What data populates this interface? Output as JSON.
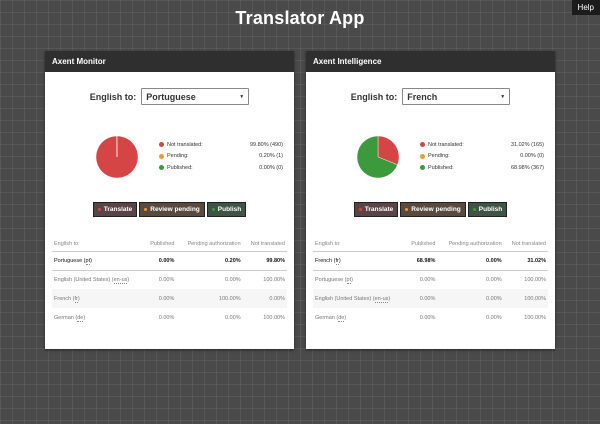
{
  "help_label": "Help",
  "app_title": "Translator App",
  "colors": {
    "not_translated": "#d64545",
    "pending": "#ee9a2b",
    "published": "#3c9a3c"
  },
  "legend_labels": {
    "not_translated": "Not translated:",
    "pending": "Pending:",
    "published": "Published:"
  },
  "buttons": {
    "translate": "Translate",
    "review": "Review pending",
    "publish": "Publish"
  },
  "table_headers": [
    "English to:",
    "Published",
    "Pending authorization",
    "Not translated"
  ],
  "panels": [
    {
      "title": "Axent Monitor",
      "source_label": "English to:",
      "selected_language": "Portuguese",
      "stats": {
        "not_translated": "99.80% (490)",
        "pending": "0.20% (1)",
        "published": "0.00% (0)"
      },
      "chart_data": {
        "type": "pie",
        "values": [
          99.8,
          0.2,
          0.0
        ]
      },
      "rows": [
        {
          "lang": "Portuguese",
          "code": "pt",
          "published": "0.00%",
          "pending": "0.20%",
          "not_translated": "99.80%"
        },
        {
          "lang": "English (United States)",
          "code": "en-us",
          "published": "0.00%",
          "pending": "0.00%",
          "not_translated": "100.00%"
        },
        {
          "lang": "French",
          "code": "fr",
          "published": "0.00%",
          "pending": "100.00%",
          "not_translated": "0.00%"
        },
        {
          "lang": "German",
          "code": "de",
          "published": "0.00%",
          "pending": "0.00%",
          "not_translated": "100.00%"
        }
      ]
    },
    {
      "title": "Axent Intelligence",
      "source_label": "English to:",
      "selected_language": "French",
      "stats": {
        "not_translated": "31.02% (165)",
        "pending": "0.00% (0)",
        "published": "68.98% (367)"
      },
      "chart_data": {
        "type": "pie",
        "values": [
          31.02,
          0.0,
          68.98
        ]
      },
      "rows": [
        {
          "lang": "French",
          "code": "fr",
          "published": "68.98%",
          "pending": "0.00%",
          "not_translated": "31.02%"
        },
        {
          "lang": "Portuguese",
          "code": "pt",
          "published": "0.00%",
          "pending": "0.00%",
          "not_translated": "100.00%"
        },
        {
          "lang": "English (United States)",
          "code": "en-us",
          "published": "0.00%",
          "pending": "0.00%",
          "not_translated": "100.00%"
        },
        {
          "lang": "German",
          "code": "de",
          "published": "0.00%",
          "pending": "0.00%",
          "not_translated": "100.00%"
        }
      ]
    }
  ]
}
